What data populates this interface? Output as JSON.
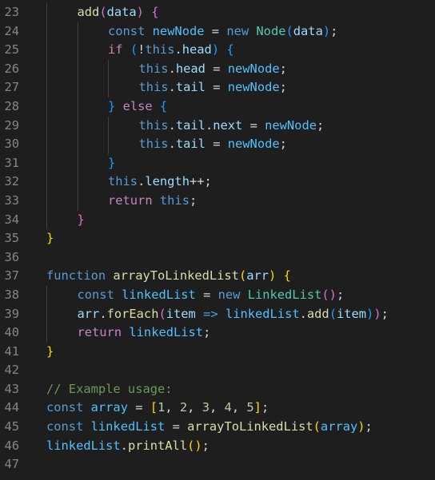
{
  "colors": {
    "background": "#1e1e1e",
    "line_number": "#858585",
    "keyword_blue": "#569cd6",
    "control_purple": "#c586c0",
    "function_yellow": "#dcdcaa",
    "variable_lightblue": "#9cdcfe",
    "constant_blue": "#4fc1ff",
    "class_teal": "#4ec9b0",
    "number_green": "#b5cea8",
    "comment_green": "#6a9955",
    "bracket_gold": "#ffd700",
    "bracket_purple": "#da70d6",
    "bracket_blue": "#179fff",
    "default_text": "#d4d4d4"
  },
  "editor": {
    "lines": [
      {
        "number": "23",
        "indent": 1,
        "tokens": [
          {
            "t": "add",
            "c": "function_yellow"
          },
          {
            "t": "(",
            "c": "bracket_purple"
          },
          {
            "t": "data",
            "c": "variable_lightblue"
          },
          {
            "t": ")",
            "c": "bracket_purple"
          },
          {
            "t": " ",
            "c": "default_text"
          },
          {
            "t": "{",
            "c": "bracket_purple"
          }
        ]
      },
      {
        "number": "24",
        "indent": 2,
        "tokens": [
          {
            "t": "const",
            "c": "keyword_blue"
          },
          {
            "t": " ",
            "c": "default_text"
          },
          {
            "t": "newNode",
            "c": "constant_blue"
          },
          {
            "t": " = ",
            "c": "default_text"
          },
          {
            "t": "new",
            "c": "keyword_blue"
          },
          {
            "t": " ",
            "c": "default_text"
          },
          {
            "t": "Node",
            "c": "class_teal"
          },
          {
            "t": "(",
            "c": "bracket_blue"
          },
          {
            "t": "data",
            "c": "variable_lightblue"
          },
          {
            "t": ")",
            "c": "bracket_blue"
          },
          {
            "t": ";",
            "c": "default_text"
          }
        ]
      },
      {
        "number": "25",
        "indent": 2,
        "tokens": [
          {
            "t": "if",
            "c": "control_purple"
          },
          {
            "t": " ",
            "c": "default_text"
          },
          {
            "t": "(",
            "c": "bracket_blue"
          },
          {
            "t": "!",
            "c": "default_text"
          },
          {
            "t": "this",
            "c": "keyword_blue"
          },
          {
            "t": ".",
            "c": "default_text"
          },
          {
            "t": "head",
            "c": "variable_lightblue"
          },
          {
            "t": ")",
            "c": "bracket_blue"
          },
          {
            "t": " ",
            "c": "default_text"
          },
          {
            "t": "{",
            "c": "bracket_blue"
          }
        ]
      },
      {
        "number": "26",
        "indent": 3,
        "tokens": [
          {
            "t": "this",
            "c": "keyword_blue"
          },
          {
            "t": ".",
            "c": "default_text"
          },
          {
            "t": "head",
            "c": "variable_lightblue"
          },
          {
            "t": " = ",
            "c": "default_text"
          },
          {
            "t": "newNode",
            "c": "constant_blue"
          },
          {
            "t": ";",
            "c": "default_text"
          }
        ]
      },
      {
        "number": "27",
        "indent": 3,
        "tokens": [
          {
            "t": "this",
            "c": "keyword_blue"
          },
          {
            "t": ".",
            "c": "default_text"
          },
          {
            "t": "tail",
            "c": "variable_lightblue"
          },
          {
            "t": " = ",
            "c": "default_text"
          },
          {
            "t": "newNode",
            "c": "constant_blue"
          },
          {
            "t": ";",
            "c": "default_text"
          }
        ]
      },
      {
        "number": "28",
        "indent": 2,
        "tokens": [
          {
            "t": "}",
            "c": "bracket_blue"
          },
          {
            "t": " ",
            "c": "default_text"
          },
          {
            "t": "else",
            "c": "control_purple"
          },
          {
            "t": " ",
            "c": "default_text"
          },
          {
            "t": "{",
            "c": "bracket_blue"
          }
        ]
      },
      {
        "number": "29",
        "indent": 3,
        "tokens": [
          {
            "t": "this",
            "c": "keyword_blue"
          },
          {
            "t": ".",
            "c": "default_text"
          },
          {
            "t": "tail",
            "c": "variable_lightblue"
          },
          {
            "t": ".",
            "c": "default_text"
          },
          {
            "t": "next",
            "c": "variable_lightblue"
          },
          {
            "t": " = ",
            "c": "default_text"
          },
          {
            "t": "newNode",
            "c": "constant_blue"
          },
          {
            "t": ";",
            "c": "default_text"
          }
        ]
      },
      {
        "number": "30",
        "indent": 3,
        "tokens": [
          {
            "t": "this",
            "c": "keyword_blue"
          },
          {
            "t": ".",
            "c": "default_text"
          },
          {
            "t": "tail",
            "c": "variable_lightblue"
          },
          {
            "t": " = ",
            "c": "default_text"
          },
          {
            "t": "newNode",
            "c": "constant_blue"
          },
          {
            "t": ";",
            "c": "default_text"
          }
        ]
      },
      {
        "number": "31",
        "indent": 2,
        "tokens": [
          {
            "t": "}",
            "c": "bracket_blue"
          }
        ]
      },
      {
        "number": "32",
        "indent": 2,
        "tokens": [
          {
            "t": "this",
            "c": "keyword_blue"
          },
          {
            "t": ".",
            "c": "default_text"
          },
          {
            "t": "length",
            "c": "variable_lightblue"
          },
          {
            "t": "++;",
            "c": "default_text"
          }
        ]
      },
      {
        "number": "33",
        "indent": 2,
        "tokens": [
          {
            "t": "return",
            "c": "control_purple"
          },
          {
            "t": " ",
            "c": "default_text"
          },
          {
            "t": "this",
            "c": "keyword_blue"
          },
          {
            "t": ";",
            "c": "default_text"
          }
        ]
      },
      {
        "number": "34",
        "indent": 1,
        "tokens": [
          {
            "t": "}",
            "c": "bracket_purple"
          }
        ]
      },
      {
        "number": "35",
        "indent": 0,
        "tokens": [
          {
            "t": "}",
            "c": "bracket_gold"
          }
        ]
      },
      {
        "number": "36",
        "indent": 0,
        "tokens": []
      },
      {
        "number": "37",
        "indent": 0,
        "tokens": [
          {
            "t": "function",
            "c": "keyword_blue"
          },
          {
            "t": " ",
            "c": "default_text"
          },
          {
            "t": "arrayToLinkedList",
            "c": "function_yellow"
          },
          {
            "t": "(",
            "c": "bracket_gold"
          },
          {
            "t": "arr",
            "c": "variable_lightblue"
          },
          {
            "t": ")",
            "c": "bracket_gold"
          },
          {
            "t": " ",
            "c": "default_text"
          },
          {
            "t": "{",
            "c": "bracket_gold"
          }
        ]
      },
      {
        "number": "38",
        "indent": 1,
        "tokens": [
          {
            "t": "const",
            "c": "keyword_blue"
          },
          {
            "t": " ",
            "c": "default_text"
          },
          {
            "t": "linkedList",
            "c": "constant_blue"
          },
          {
            "t": " = ",
            "c": "default_text"
          },
          {
            "t": "new",
            "c": "keyword_blue"
          },
          {
            "t": " ",
            "c": "default_text"
          },
          {
            "t": "LinkedList",
            "c": "class_teal"
          },
          {
            "t": "(",
            "c": "bracket_purple"
          },
          {
            "t": ")",
            "c": "bracket_purple"
          },
          {
            "t": ";",
            "c": "default_text"
          }
        ]
      },
      {
        "number": "39",
        "indent": 1,
        "tokens": [
          {
            "t": "arr",
            "c": "variable_lightblue"
          },
          {
            "t": ".",
            "c": "default_text"
          },
          {
            "t": "forEach",
            "c": "function_yellow"
          },
          {
            "t": "(",
            "c": "bracket_purple"
          },
          {
            "t": "item",
            "c": "variable_lightblue"
          },
          {
            "t": " ",
            "c": "default_text"
          },
          {
            "t": "=>",
            "c": "keyword_blue"
          },
          {
            "t": " ",
            "c": "default_text"
          },
          {
            "t": "linkedList",
            "c": "constant_blue"
          },
          {
            "t": ".",
            "c": "default_text"
          },
          {
            "t": "add",
            "c": "function_yellow"
          },
          {
            "t": "(",
            "c": "bracket_blue"
          },
          {
            "t": "item",
            "c": "variable_lightblue"
          },
          {
            "t": ")",
            "c": "bracket_blue"
          },
          {
            "t": ")",
            "c": "bracket_purple"
          },
          {
            "t": ";",
            "c": "default_text"
          }
        ]
      },
      {
        "number": "40",
        "indent": 1,
        "tokens": [
          {
            "t": "return",
            "c": "control_purple"
          },
          {
            "t": " ",
            "c": "default_text"
          },
          {
            "t": "linkedList",
            "c": "constant_blue"
          },
          {
            "t": ";",
            "c": "default_text"
          }
        ]
      },
      {
        "number": "41",
        "indent": 0,
        "tokens": [
          {
            "t": "}",
            "c": "bracket_gold"
          }
        ]
      },
      {
        "number": "42",
        "indent": 0,
        "tokens": []
      },
      {
        "number": "43",
        "indent": 0,
        "tokens": [
          {
            "t": "// Example usage:",
            "c": "comment_green"
          }
        ]
      },
      {
        "number": "44",
        "indent": 0,
        "tokens": [
          {
            "t": "const",
            "c": "keyword_blue"
          },
          {
            "t": " ",
            "c": "default_text"
          },
          {
            "t": "array",
            "c": "constant_blue"
          },
          {
            "t": " = ",
            "c": "default_text"
          },
          {
            "t": "[",
            "c": "bracket_gold"
          },
          {
            "t": "1",
            "c": "number_green"
          },
          {
            "t": ", ",
            "c": "default_text"
          },
          {
            "t": "2",
            "c": "number_green"
          },
          {
            "t": ", ",
            "c": "default_text"
          },
          {
            "t": "3",
            "c": "number_green"
          },
          {
            "t": ", ",
            "c": "default_text"
          },
          {
            "t": "4",
            "c": "number_green"
          },
          {
            "t": ", ",
            "c": "default_text"
          },
          {
            "t": "5",
            "c": "number_green"
          },
          {
            "t": "]",
            "c": "bracket_gold"
          },
          {
            "t": ";",
            "c": "default_text"
          }
        ]
      },
      {
        "number": "45",
        "indent": 0,
        "tokens": [
          {
            "t": "const",
            "c": "keyword_blue"
          },
          {
            "t": " ",
            "c": "default_text"
          },
          {
            "t": "linkedList",
            "c": "constant_blue"
          },
          {
            "t": " = ",
            "c": "default_text"
          },
          {
            "t": "arrayToLinkedList",
            "c": "function_yellow"
          },
          {
            "t": "(",
            "c": "bracket_gold"
          },
          {
            "t": "array",
            "c": "constant_blue"
          },
          {
            "t": ")",
            "c": "bracket_gold"
          },
          {
            "t": ";",
            "c": "default_text"
          }
        ]
      },
      {
        "number": "46",
        "indent": 0,
        "tokens": [
          {
            "t": "linkedList",
            "c": "constant_blue"
          },
          {
            "t": ".",
            "c": "default_text"
          },
          {
            "t": "printAll",
            "c": "function_yellow"
          },
          {
            "t": "(",
            "c": "bracket_gold"
          },
          {
            "t": ")",
            "c": "bracket_gold"
          },
          {
            "t": ";",
            "c": "default_text"
          }
        ]
      },
      {
        "number": "47",
        "indent": 0,
        "tokens": []
      }
    ]
  }
}
